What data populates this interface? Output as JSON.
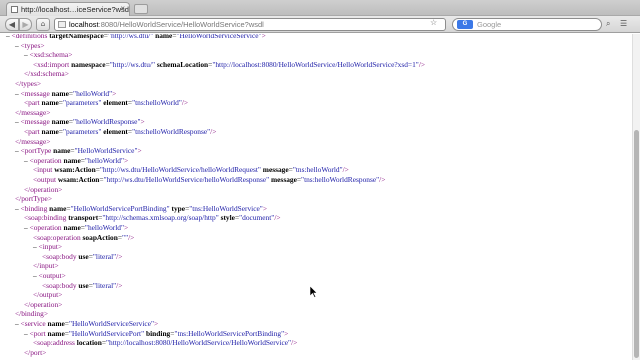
{
  "tab": {
    "title": "http://localhost…iceService?wsdl",
    "close": "×"
  },
  "toolbar": {
    "back": "◀",
    "forward": "▶",
    "sidebar": "⌂",
    "url_host": "localhost",
    "url_path": ":8080/HelloWorldService/HelloWorldService?wsdl",
    "reader": "☆",
    "search_placeholder": "Google",
    "search_engine": "G"
  },
  "xml_lines": [
    {
      "indent": 0,
      "minus": "– ",
      "pre": "<",
      "tag": "definitions",
      "attrs": [
        {
          "n": "targetNamespace",
          "v": "\"http://ws.dtu/\""
        },
        {
          "n": "name",
          "v": "\"HelloWorldServiceService\""
        }
      ],
      "post": ">"
    },
    {
      "indent": 1,
      "minus": "– ",
      "pre": "<",
      "tag": "types",
      "attrs": [],
      "post": ">"
    },
    {
      "indent": 2,
      "minus": "– ",
      "pre": "<",
      "tag": "xsd:schema",
      "attrs": [],
      "post": ">"
    },
    {
      "indent": 3,
      "minus": "",
      "pre": "<",
      "tag": "xsd:import",
      "attrs": [
        {
          "n": "namespace",
          "v": "\"http://ws.dtu/\""
        },
        {
          "n": "schemaLocation",
          "v": "\"http://localhost:8080/HelloWorldService/HelloWorldService?xsd=1\""
        }
      ],
      "post": "/>"
    },
    {
      "indent": 2,
      "minus": "",
      "pre": "</",
      "tag": "xsd:schema",
      "attrs": [],
      "post": ">"
    },
    {
      "indent": 1,
      "minus": "",
      "pre": "</",
      "tag": "types",
      "attrs": [],
      "post": ">"
    },
    {
      "indent": 1,
      "minus": "– ",
      "pre": "<",
      "tag": "message",
      "attrs": [
        {
          "n": "name",
          "v": "\"helloWorld\""
        }
      ],
      "post": ">"
    },
    {
      "indent": 2,
      "minus": "",
      "pre": "<",
      "tag": "part",
      "attrs": [
        {
          "n": "name",
          "v": "\"parameters\""
        },
        {
          "n": "element",
          "v": "\"tns:helloWorld\""
        }
      ],
      "post": "/>"
    },
    {
      "indent": 1,
      "minus": "",
      "pre": "</",
      "tag": "message",
      "attrs": [],
      "post": ">"
    },
    {
      "indent": 1,
      "minus": "– ",
      "pre": "<",
      "tag": "message",
      "attrs": [
        {
          "n": "name",
          "v": "\"helloWorldResponse\""
        }
      ],
      "post": ">"
    },
    {
      "indent": 2,
      "minus": "",
      "pre": "<",
      "tag": "part",
      "attrs": [
        {
          "n": "name",
          "v": "\"parameters\""
        },
        {
          "n": "element",
          "v": "\"tns:helloWorldResponse\""
        }
      ],
      "post": "/>"
    },
    {
      "indent": 1,
      "minus": "",
      "pre": "</",
      "tag": "message",
      "attrs": [],
      "post": ">"
    },
    {
      "indent": 1,
      "minus": "– ",
      "pre": "<",
      "tag": "portType",
      "attrs": [
        {
          "n": "name",
          "v": "\"HelloWorldService\""
        }
      ],
      "post": ">"
    },
    {
      "indent": 2,
      "minus": "– ",
      "pre": "<",
      "tag": "operation",
      "attrs": [
        {
          "n": "name",
          "v": "\"helloWorld\""
        }
      ],
      "post": ">"
    },
    {
      "indent": 3,
      "minus": "",
      "pre": "<",
      "tag": "input",
      "attrs": [
        {
          "n": "wsam:Action",
          "v": "\"http://ws.dtu/HelloWorldService/helloWorldRequest\""
        },
        {
          "n": "message",
          "v": "\"tns:helloWorld\""
        }
      ],
      "post": "/>"
    },
    {
      "indent": 3,
      "minus": "",
      "pre": "<",
      "tag": "output",
      "attrs": [
        {
          "n": "wsam:Action",
          "v": "\"http://ws.dtu/HelloWorldService/helloWorldResponse\""
        },
        {
          "n": "message",
          "v": "\"tns:helloWorldResponse\""
        }
      ],
      "post": "/>"
    },
    {
      "indent": 2,
      "minus": "",
      "pre": "</",
      "tag": "operation",
      "attrs": [],
      "post": ">"
    },
    {
      "indent": 1,
      "minus": "",
      "pre": "</",
      "tag": "portType",
      "attrs": [],
      "post": ">"
    },
    {
      "indent": 1,
      "minus": "– ",
      "pre": "<",
      "tag": "binding",
      "attrs": [
        {
          "n": "name",
          "v": "\"HelloWorldServicePortBinding\""
        },
        {
          "n": "type",
          "v": "\"tns:HelloWorldService\""
        }
      ],
      "post": ">"
    },
    {
      "indent": 2,
      "minus": "",
      "pre": "<",
      "tag": "soap:binding",
      "attrs": [
        {
          "n": "transport",
          "v": "\"http://schemas.xmlsoap.org/soap/http\""
        },
        {
          "n": "style",
          "v": "\"document\""
        }
      ],
      "post": "/>"
    },
    {
      "indent": 2,
      "minus": "– ",
      "pre": "<",
      "tag": "operation",
      "attrs": [
        {
          "n": "name",
          "v": "\"helloWorld\""
        }
      ],
      "post": ">"
    },
    {
      "indent": 3,
      "minus": "",
      "pre": "<",
      "tag": "soap:operation",
      "attrs": [
        {
          "n": "soapAction",
          "v": "\"\""
        }
      ],
      "post": "/>"
    },
    {
      "indent": 3,
      "minus": "– ",
      "pre": "<",
      "tag": "input",
      "attrs": [],
      "post": ">"
    },
    {
      "indent": 4,
      "minus": "",
      "pre": "<",
      "tag": "soap:body",
      "attrs": [
        {
          "n": "use",
          "v": "\"literal\""
        }
      ],
      "post": "/>"
    },
    {
      "indent": 3,
      "minus": "",
      "pre": "</",
      "tag": "input",
      "attrs": [],
      "post": ">"
    },
    {
      "indent": 3,
      "minus": "– ",
      "pre": "<",
      "tag": "output",
      "attrs": [],
      "post": ">"
    },
    {
      "indent": 4,
      "minus": "",
      "pre": "<",
      "tag": "soap:body",
      "attrs": [
        {
          "n": "use",
          "v": "\"literal\""
        }
      ],
      "post": "/>"
    },
    {
      "indent": 3,
      "minus": "",
      "pre": "</",
      "tag": "output",
      "attrs": [],
      "post": ">"
    },
    {
      "indent": 2,
      "minus": "",
      "pre": "</",
      "tag": "operation",
      "attrs": [],
      "post": ">"
    },
    {
      "indent": 1,
      "minus": "",
      "pre": "</",
      "tag": "binding",
      "attrs": [],
      "post": ">"
    },
    {
      "indent": 1,
      "minus": "– ",
      "pre": "<",
      "tag": "service",
      "attrs": [
        {
          "n": "name",
          "v": "\"HelloWorldServiceService\""
        }
      ],
      "post": ">"
    },
    {
      "indent": 2,
      "minus": "– ",
      "pre": "<",
      "tag": "port",
      "attrs": [
        {
          "n": "name",
          "v": "\"HelloWorldServicePort\""
        },
        {
          "n": "binding",
          "v": "\"tns:HelloWorldServicePortBinding\""
        }
      ],
      "post": ">"
    },
    {
      "indent": 3,
      "minus": "",
      "pre": "<",
      "tag": "soap:address",
      "attrs": [
        {
          "n": "location",
          "v": "\"http://localhost:8080/HelloWorldService/HelloWorldService\""
        }
      ],
      "post": "/>"
    },
    {
      "indent": 2,
      "minus": "",
      "pre": "</",
      "tag": "port",
      "attrs": [],
      "post": ">"
    }
  ],
  "colors": {
    "tag": "#881280",
    "value": "#1a1aa6",
    "attr": "#000000"
  },
  "icons": [
    "page-icon",
    "close-icon",
    "new-tab-icon",
    "back-icon",
    "forward-icon",
    "home-icon",
    "bookmark-star-icon",
    "search-icon",
    "menu-icon",
    "mouse-cursor-icon"
  ]
}
